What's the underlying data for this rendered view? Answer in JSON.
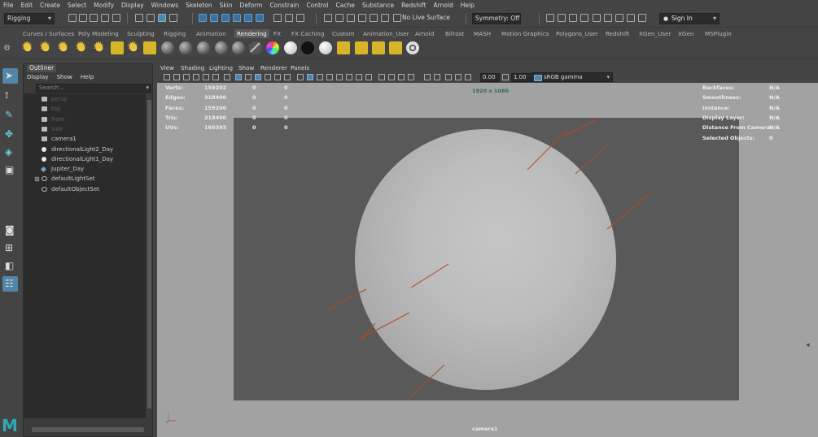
{
  "menubar": [
    "File",
    "Edit",
    "Create",
    "Select",
    "Modify",
    "Display",
    "Windows",
    "Skeleton",
    "Skin",
    "Deform",
    "Constrain",
    "Control",
    "Cache",
    "Substance",
    "Redshift",
    "Arnold",
    "Help"
  ],
  "status": {
    "mode": "Rigging",
    "live_surface": "No Live Surface",
    "symmetry": "Symmetry: Off",
    "sign_in": "Sign In"
  },
  "shelf_tabs": [
    "Curves / Surfaces",
    "Poly Modeling",
    "Sculpting",
    "Rigging",
    "Animation",
    "Rendering",
    "FX",
    "FX Caching",
    "Custom",
    "Animation_User",
    "Arnold",
    "Bifrost",
    "MASH",
    "Motion Graphics",
    "Polygons_User",
    "Redshift",
    "XGen_User",
    "XGen",
    "MSPlugin"
  ],
  "active_shelf_tab": "Rendering",
  "outliner": {
    "tab": "Outliner",
    "menu": [
      "Display",
      "Show",
      "Help"
    ],
    "search_placeholder": "Search...",
    "items": [
      {
        "label": "persp",
        "icon": "camera-icon",
        "dim": true
      },
      {
        "label": "top",
        "icon": "camera-icon",
        "dim": true
      },
      {
        "label": "front",
        "icon": "camera-icon",
        "dim": true
      },
      {
        "label": "side",
        "icon": "camera-icon",
        "dim": true
      },
      {
        "label": "camera1",
        "icon": "camera-icon",
        "dim": false
      },
      {
        "label": "directionalLight2_Day",
        "icon": "light-icon",
        "dim": false
      },
      {
        "label": "directionalLight1_Day",
        "icon": "light-icon",
        "dim": false
      },
      {
        "label": "Jupiter_Day",
        "icon": "mesh-icon",
        "dim": false
      },
      {
        "label": "defaultLightSet",
        "icon": "set-icon",
        "dim": false,
        "expandable": true
      },
      {
        "label": "defaultObjectSet",
        "icon": "set-icon",
        "dim": false
      }
    ]
  },
  "viewport": {
    "menu": [
      "View",
      "Shading",
      "Lighting",
      "Show",
      "Renderer",
      "Panels"
    ],
    "exposure": "0.00",
    "gamma": "1.00",
    "color_space": "sRGB gamma",
    "resolution": "1920 x 1080",
    "camera_name": "camera1",
    "hud_left": [
      {
        "label": "Verts:",
        "v1": "159202",
        "v2": "0",
        "v3": "0"
      },
      {
        "label": "Edges:",
        "v1": "318400",
        "v2": "0",
        "v3": "0"
      },
      {
        "label": "Faces:",
        "v1": "159200",
        "v2": "0",
        "v3": "0"
      },
      {
        "label": "Tris:",
        "v1": "318400",
        "v2": "0",
        "v3": "0"
      },
      {
        "label": "UVs:",
        "v1": "160393",
        "v2": "0",
        "v3": "0"
      }
    ],
    "hud_right": [
      {
        "label": "Backfaces:",
        "value": "N/A"
      },
      {
        "label": "Smoothness:",
        "value": "N/A"
      },
      {
        "label": "Instance:",
        "value": "N/A"
      },
      {
        "label": "Display Layer:",
        "value": "N/A"
      },
      {
        "label": "Distance From Camera:",
        "value": "N/A"
      },
      {
        "label": "Selected Objects:",
        "value": "0"
      }
    ]
  },
  "colors": {
    "ui_bg": "#444444",
    "viewport_bg": "#a2a2a2",
    "film_gate": "#595959",
    "light_line": "#b04a22",
    "selection": "#5285a6"
  }
}
